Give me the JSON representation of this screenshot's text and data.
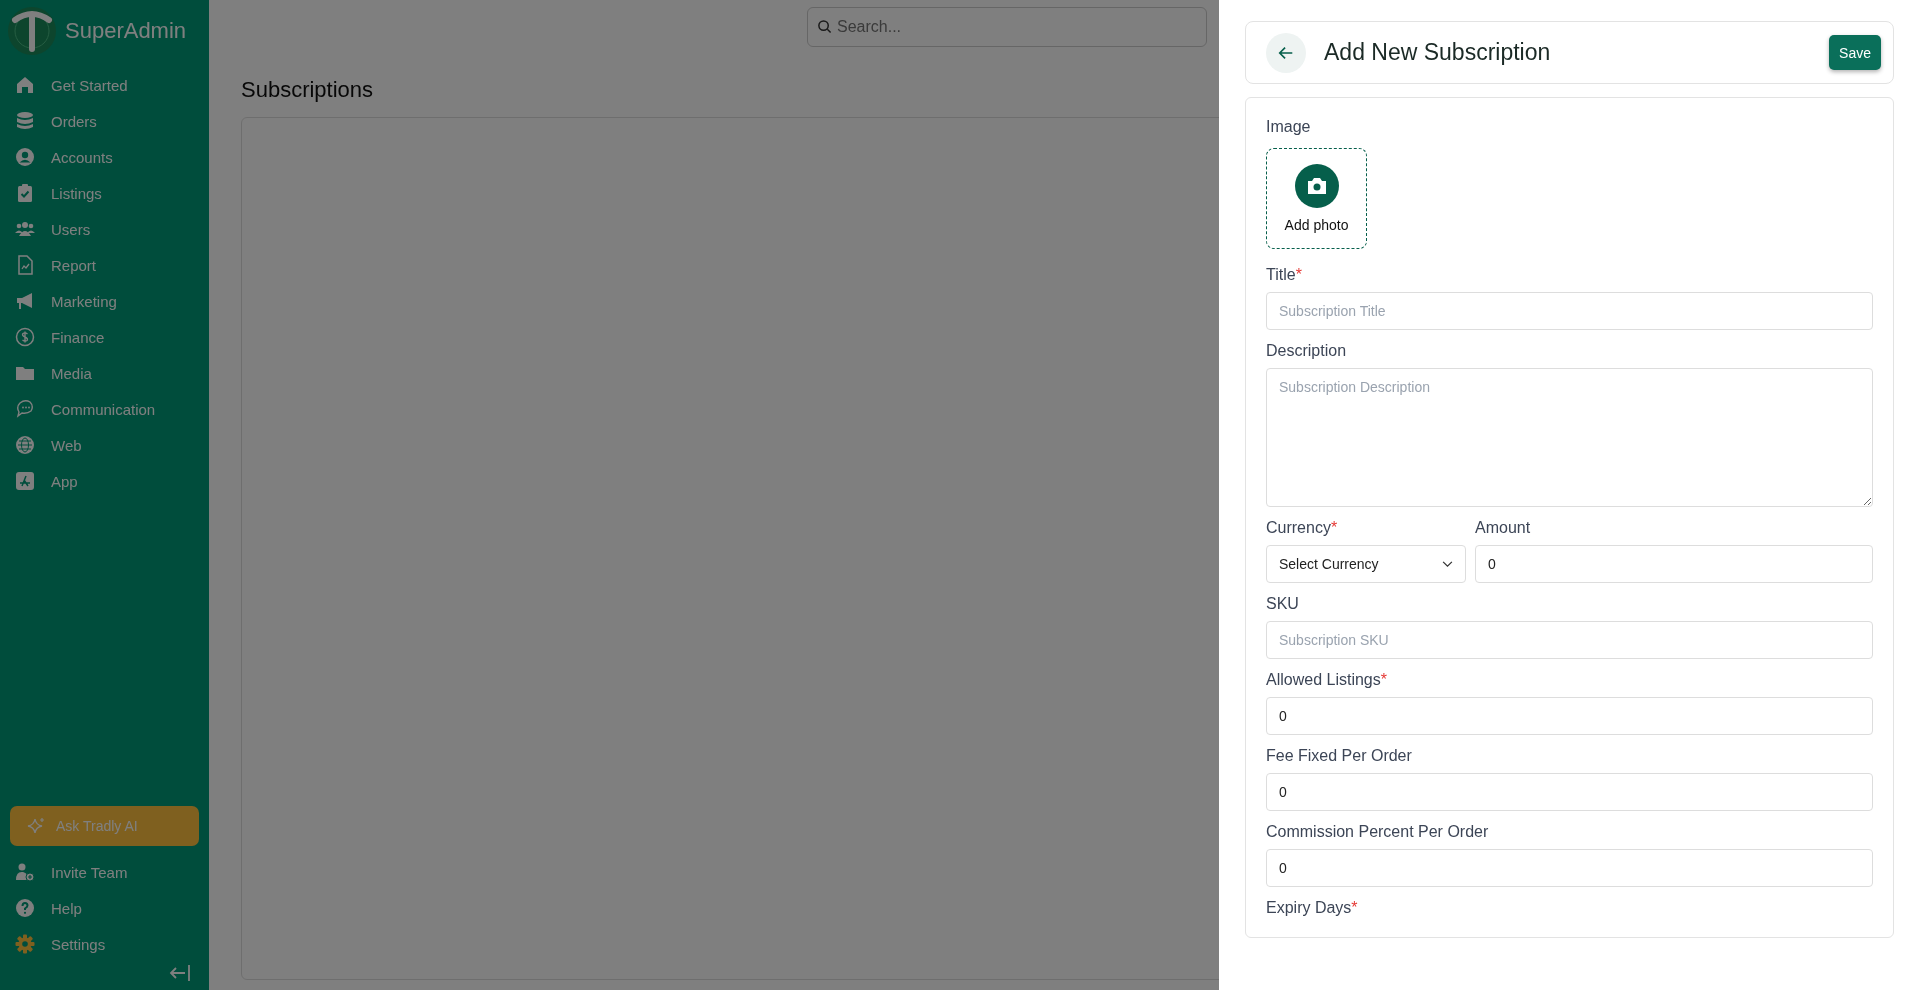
{
  "sidebar": {
    "brand": "SuperAdmin",
    "items": [
      {
        "label": "Get Started"
      },
      {
        "label": "Orders"
      },
      {
        "label": "Accounts"
      },
      {
        "label": "Listings"
      },
      {
        "label": "Users"
      },
      {
        "label": "Report"
      },
      {
        "label": "Marketing"
      },
      {
        "label": "Finance"
      },
      {
        "label": "Media"
      },
      {
        "label": "Communication"
      },
      {
        "label": "Web"
      },
      {
        "label": "App"
      }
    ],
    "ai_button": "Ask Tradly AI",
    "footer_items": [
      {
        "label": "Invite Team"
      },
      {
        "label": "Help"
      },
      {
        "label": "Settings"
      }
    ]
  },
  "search": {
    "placeholder": "Search..."
  },
  "page": {
    "title": "Subscriptions"
  },
  "drawer": {
    "title": "Add New Subscription",
    "save": "Save",
    "image": {
      "label": "Image",
      "button": "Add photo"
    },
    "rows": [
      [
        {
          "kind": "text",
          "label": "Title",
          "required_mark": "*",
          "placeholder": "Subscription Title"
        }
      ],
      [
        {
          "kind": "textarea",
          "label": "Description",
          "placeholder": "Subscription Description"
        }
      ],
      [
        {
          "kind": "select",
          "label": "Currency",
          "required_mark": "*",
          "value": "Select Currency"
        },
        {
          "kind": "text",
          "label": "Amount",
          "value": "0"
        }
      ],
      [
        {
          "kind": "text",
          "label": "SKU",
          "placeholder": "Subscription SKU"
        }
      ],
      [
        {
          "kind": "text",
          "label": "Allowed Listings",
          "required_mark": "*",
          "value": "0"
        }
      ],
      [
        {
          "kind": "text",
          "label": "Fee Fixed Per Order",
          "value": "0"
        }
      ],
      [
        {
          "kind": "text",
          "label": "Commission Percent Per Order",
          "value": "0"
        }
      ],
      [
        {
          "kind": "label",
          "label": "Expiry Days",
          "required_mark": "*"
        }
      ]
    ]
  }
}
